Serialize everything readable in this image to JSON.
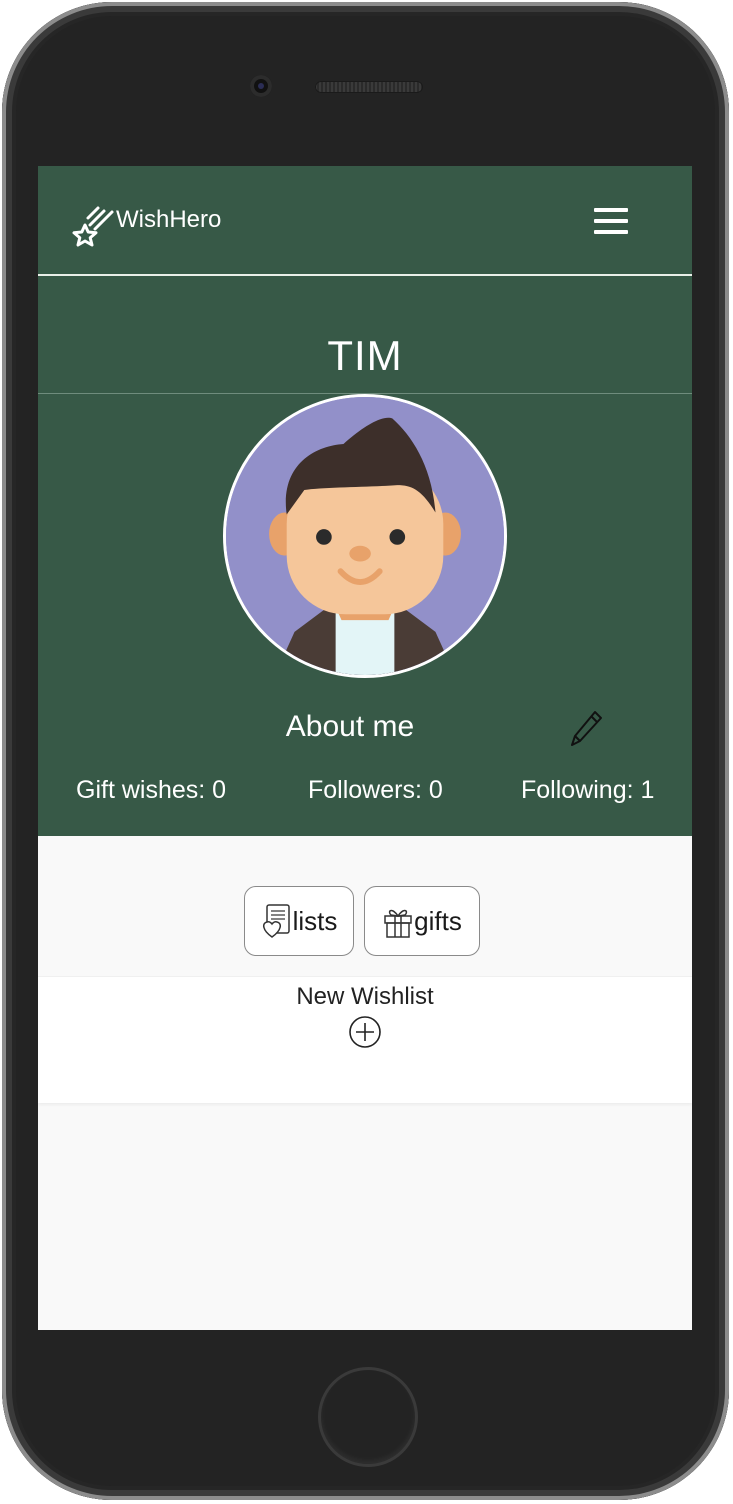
{
  "app": {
    "brand": "WishHero"
  },
  "profile": {
    "name": "TIM",
    "about_label": "About me",
    "stats": {
      "gift_wishes": "Gift wishes: 0",
      "followers": "Followers: 0",
      "following": "Following: 1"
    }
  },
  "tabs": [
    {
      "label": "lists",
      "icon": "heart-list-icon"
    },
    {
      "label": "gifts",
      "icon": "gift-icon"
    }
  ],
  "wishlist": {
    "new_label": "New Wishlist",
    "add_icon": "plus-circle-icon"
  },
  "colors": {
    "header": "#375947",
    "avatar_bg": "#9290c9",
    "content_bg": "#f9f9f9"
  }
}
